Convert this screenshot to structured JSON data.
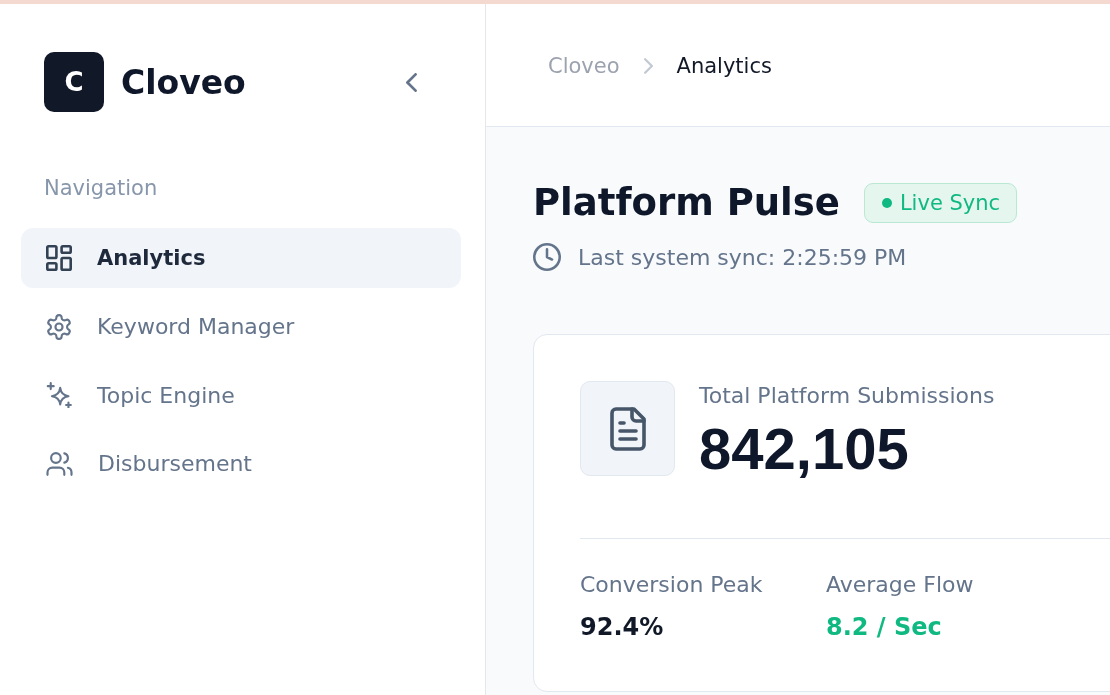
{
  "sidebar": {
    "brand": {
      "logo_letter": "C",
      "name": "Cloveo"
    },
    "section_title": "Navigation",
    "items": [
      {
        "label": "Analytics",
        "selected": true
      },
      {
        "label": "Keyword Manager",
        "selected": false
      },
      {
        "label": "Topic Engine",
        "selected": false
      },
      {
        "label": "Disbursement",
        "selected": false
      }
    ]
  },
  "header": {
    "breadcrumb": [
      {
        "label": "Cloveo",
        "current": false
      },
      {
        "label": "Analytics",
        "current": true
      }
    ]
  },
  "page": {
    "title": "Platform Pulse",
    "status_badge": "Live Sync",
    "last_sync": "Last system sync: 2:25:59 PM"
  },
  "summary_card": {
    "label": "Total Platform Submissions",
    "value": "842,105",
    "stats": [
      {
        "label": "Conversion Peak",
        "value": "92.4%",
        "color": "#111827"
      },
      {
        "label": "Average Flow",
        "value": "8.2 / Sec",
        "color": "#10b981"
      }
    ]
  }
}
